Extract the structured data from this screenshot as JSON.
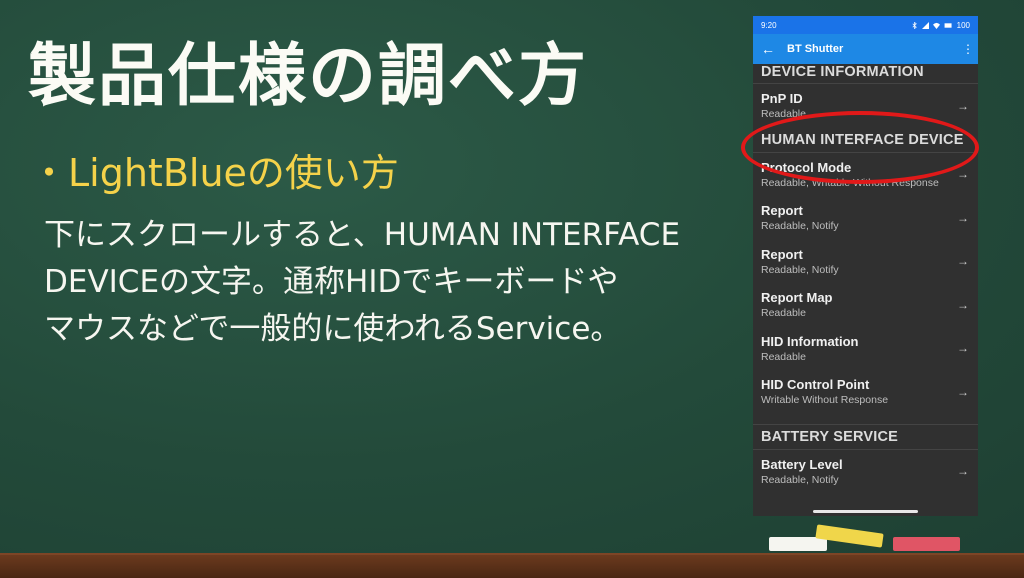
{
  "slide": {
    "title": "製品仕様の調べ方",
    "bullet": "・LightBlueの使い方",
    "body_lines": [
      "下にスクロールすると、HUMAN INTERFACE",
      "DEVICEの文字。通称HIDでキーボードや",
      "マウスなどで一般的に使われるService。"
    ]
  },
  "phone": {
    "status": {
      "time": "9:20",
      "battery": "100"
    },
    "appbar": {
      "title": "BT Shutter",
      "back_icon": "arrow-left-icon",
      "menu_icon": "more-vertical-icon"
    },
    "sections": [
      {
        "title": "DEVICE INFORMATION",
        "items": [
          {
            "name": "PnP ID",
            "props": "Readable"
          }
        ]
      },
      {
        "title": "HUMAN INTERFACE DEVICE",
        "items": [
          {
            "name": "Protocol Mode",
            "props": "Readable, Writable Without Response"
          },
          {
            "name": "Report",
            "props": "Readable, Notify"
          },
          {
            "name": "Report",
            "props": "Readable, Notify"
          },
          {
            "name": "Report Map",
            "props": "Readable"
          },
          {
            "name": "HID Information",
            "props": "Readable"
          },
          {
            "name": "HID Control Point",
            "props": "Writable Without Response"
          }
        ]
      },
      {
        "title": "BATTERY SERVICE",
        "items": [
          {
            "name": "Battery Level",
            "props": "Readable, Notify"
          }
        ]
      }
    ]
  },
  "colors": {
    "board": "#244a3c",
    "chalk_yellow": "#f5d24a",
    "appbar_blue": "#1e88e5",
    "highlight_red": "#e11919"
  }
}
